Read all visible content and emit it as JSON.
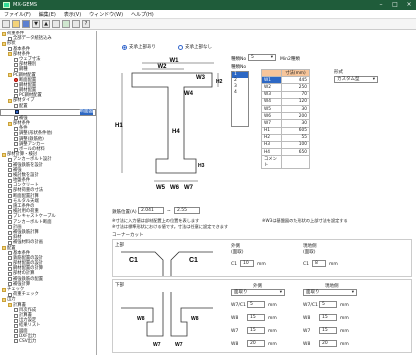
{
  "app": {
    "title": "MX-GEMS"
  },
  "menu": [
    "ファイル(F)",
    "編集(E)",
    "表示(V)",
    "ウィンドウ(W)",
    "ヘルプ(H)"
  ],
  "tree": [
    {
      "label": "荷重条件",
      "indent": 0,
      "icon": "folder"
    },
    {
      "label": "全部データ統括込み",
      "indent": 1,
      "icon": "file"
    },
    {
      "label": "形状",
      "indent": 0,
      "icon": "folder"
    },
    {
      "label": "基本条件",
      "indent": 1,
      "icon": "file"
    },
    {
      "label": "部材条件",
      "indent": 1,
      "icon": "folder"
    },
    {
      "label": "ウェブ寸法",
      "indent": 2,
      "icon": "file"
    },
    {
      "label": "部材種別",
      "indent": 2,
      "icon": "file"
    },
    {
      "label": "鋼種",
      "indent": 2,
      "icon": "file"
    },
    {
      "label": "PC鋼材配置",
      "indent": 1,
      "icon": "folder"
    },
    {
      "label": "断面配置",
      "indent": 2,
      "icon": "red"
    },
    {
      "label": "鋼材配置",
      "indent": 2,
      "icon": "file"
    },
    {
      "label": "鋼材配置",
      "indent": 2,
      "icon": "file"
    },
    {
      "label": "PC鋼材配置",
      "indent": 2,
      "icon": "file"
    },
    {
      "label": "部材タイプ",
      "indent": 1,
      "icon": "folder"
    },
    {
      "label": "配置",
      "indent": 2,
      "icon": "file"
    },
    {
      "label": "断面図",
      "indent": 2,
      "icon": "blue",
      "selected": true
    },
    {
      "label": "補強",
      "indent": 2,
      "icon": "file"
    },
    {
      "label": "部材条件",
      "indent": 1,
      "icon": "folder"
    },
    {
      "label": "条件",
      "indent": 2,
      "icon": "file"
    },
    {
      "label": "調整(形状条件他)",
      "indent": 2,
      "icon": "file"
    },
    {
      "label": "調整(鉄筋他)",
      "indent": 2,
      "icon": "file"
    },
    {
      "label": "調整アンカー",
      "indent": 2,
      "icon": "file"
    },
    {
      "label": "ボールの材料",
      "indent": 2,
      "icon": "file"
    },
    {
      "label": "部材計算・検討",
      "indent": 0,
      "icon": "folder"
    },
    {
      "label": "アンカーボルト設計",
      "indent": 1,
      "icon": "file"
    },
    {
      "label": "補強鉄筋を設計",
      "indent": 1,
      "icon": "file"
    },
    {
      "label": "補強",
      "indent": 1,
      "icon": "file"
    },
    {
      "label": "検討数を設計",
      "indent": 1,
      "icon": "file"
    },
    {
      "label": "地盤条件",
      "indent": 1,
      "icon": "file"
    },
    {
      "label": "コンクリート",
      "indent": 1,
      "icon": "file"
    },
    {
      "label": "部材荷重の寸法",
      "indent": 1,
      "icon": "file"
    },
    {
      "label": "断面配置計算",
      "indent": 1,
      "icon": "file"
    },
    {
      "label": "モルタル天端",
      "indent": 1,
      "icon": "file"
    },
    {
      "label": "施工条件の",
      "indent": 1,
      "icon": "file"
    },
    {
      "label": "検討用の荷重",
      "indent": 1,
      "icon": "file"
    },
    {
      "label": "プレキャストケーブル",
      "indent": 1,
      "icon": "file"
    },
    {
      "label": "アンカーボルト断面",
      "indent": 1,
      "icon": "file"
    },
    {
      "label": "計画",
      "indent": 1,
      "icon": "file"
    },
    {
      "label": "補強鉄筋計算",
      "indent": 1,
      "icon": "file"
    },
    {
      "label": "斜材",
      "indent": 1,
      "icon": "file"
    },
    {
      "label": "補強材料の計画",
      "indent": 1,
      "icon": "file"
    },
    {
      "label": "配置",
      "indent": 0,
      "icon": "folder"
    },
    {
      "label": "基本条件",
      "indent": 1,
      "icon": "file"
    },
    {
      "label": "鉄筋配置の設計",
      "indent": 1,
      "icon": "file"
    },
    {
      "label": "部材配置の設計",
      "indent": 1,
      "icon": "file"
    },
    {
      "label": "鋼材配置の計算",
      "indent": 1,
      "icon": "file"
    },
    {
      "label": "部材の計算",
      "indent": 1,
      "icon": "file"
    },
    {
      "label": "補強鉄筋の配置",
      "indent": 1,
      "icon": "file"
    },
    {
      "label": "補強計算",
      "indent": 1,
      "icon": "file"
    },
    {
      "label": "チェック",
      "indent": 0,
      "icon": "folder"
    },
    {
      "label": "荷重チェック",
      "indent": 1,
      "icon": "file"
    },
    {
      "label": "出力",
      "indent": 0,
      "icon": "folder"
    },
    {
      "label": "計算書",
      "indent": 1,
      "icon": "folder"
    },
    {
      "label": "目次作成",
      "indent": 2,
      "icon": "file"
    },
    {
      "label": "計算書",
      "indent": 2,
      "icon": "file"
    },
    {
      "label": "出力設定",
      "indent": 2,
      "icon": "file"
    },
    {
      "label": "結果リスト",
      "indent": 2,
      "icon": "file"
    },
    {
      "label": "図面",
      "indent": 2,
      "icon": "file"
    },
    {
      "label": "DXF出力",
      "indent": 2,
      "icon": "file"
    },
    {
      "label": "CSV出力",
      "indent": 2,
      "icon": "file"
    }
  ],
  "main": {
    "radio_a": "支承上部あり",
    "radio_b": "支承上部なし",
    "shape_label": "種類No",
    "shape_value": "5",
    "shape_unit": "Min2種類",
    "type_list_title": "種類No",
    "type_list": [
      "1",
      "2",
      "3",
      "4"
    ],
    "keijo_label": "形式",
    "keijo_value": "カスタム型",
    "table_header": [
      "",
      "寸法(mm)"
    ],
    "table": [
      {
        "k": "W1",
        "v": "445"
      },
      {
        "k": "W2",
        "v": "250"
      },
      {
        "k": "W3",
        "v": "70"
      },
      {
        "k": "W4",
        "v": "120"
      },
      {
        "k": "W5",
        "v": "30"
      },
      {
        "k": "W6",
        "v": "200"
      },
      {
        "k": "W7",
        "v": "30"
      },
      {
        "k": "H1",
        "v": "605"
      },
      {
        "k": "H2",
        "v": "55"
      },
      {
        "k": "H3",
        "v": "100"
      },
      {
        "k": "H4",
        "v": "650"
      },
      {
        "k": "コメント",
        "v": ""
      }
    ],
    "angle_label": "鉄筋位置(A)",
    "angle_from": "2.041",
    "angle_sep": "~",
    "angle_to": "2.55",
    "notes": [
      "※寸法に入力値は部材配置上の位置を表します",
      "※寸法は標準形状における値です。寸法は任意に設定できます"
    ],
    "side_note": "※W3は基盤図のた形状の上部寸法を設定する",
    "corner_title": "コーナーカット",
    "upper_label": "上部",
    "upper_c_left": "C1",
    "upper_c_right": "C1",
    "upper_left_title": "外側",
    "upper_left_sub": "(面取)",
    "upper_left_field": "C1",
    "upper_left_value": "10",
    "upper_left_unit": "mm",
    "upper_right_title": "現地側",
    "upper_right_sub": "(面取)",
    "upper_right_field": "C1",
    "upper_right_value": "8",
    "upper_right_unit": "mm",
    "lower_label": "下部",
    "lower_left_title": "外側",
    "lower_right_title": "現地側",
    "lower_left_select": "面取り",
    "lower_right_select": "面取り",
    "lower_fields": [
      {
        "k": "W7/C1",
        "v": "5",
        "u": "mm"
      },
      {
        "k": "W8",
        "v": "15",
        "u": "mm"
      },
      {
        "k": "W7",
        "v": "15",
        "u": "mm"
      },
      {
        "k": "W8",
        "v": "20",
        "u": "mm"
      }
    ],
    "lower_fields_r": [
      {
        "k": "W7/C1",
        "v": "5",
        "u": "mm"
      },
      {
        "k": "W8",
        "v": "15",
        "u": "mm"
      },
      {
        "k": "W7",
        "v": "15",
        "u": "mm"
      },
      {
        "k": "W8",
        "v": "20",
        "u": "mm"
      }
    ],
    "dims": {
      "W1": "W1",
      "W2": "W2",
      "W3": "W3",
      "W4": "W4",
      "W5": "W5",
      "W6": "W6",
      "W7": "W7",
      "H1": "H1",
      "H2": "H2",
      "H3": "H3",
      "H4": "H4"
    },
    "lower_shape_labels": {
      "a": "W8",
      "b": "W8",
      "c": "W7",
      "d": "W7"
    }
  }
}
